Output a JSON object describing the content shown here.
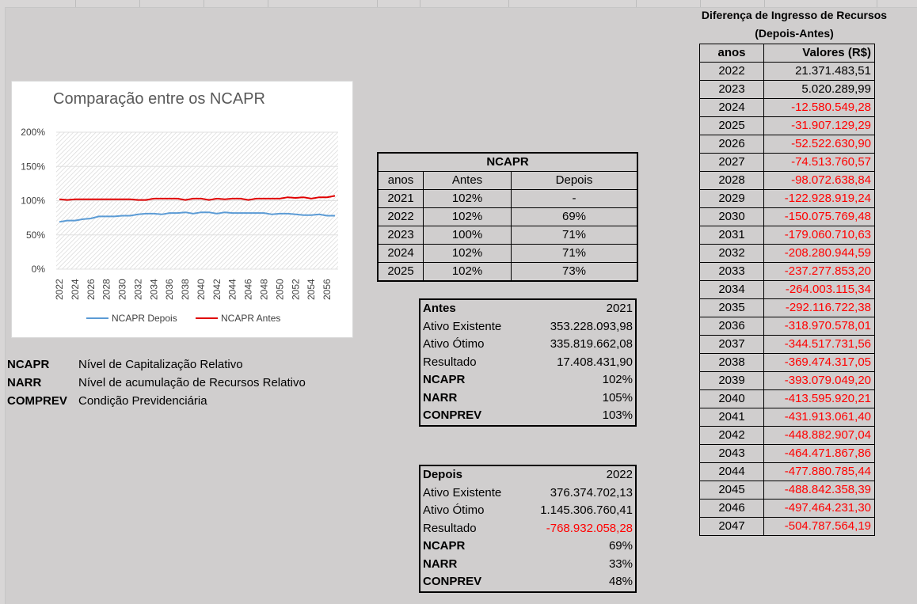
{
  "chart_data": {
    "type": "line",
    "title": "Comparação entre os NCAPR",
    "yticks": [
      "200%",
      "150%",
      "100%",
      "50%",
      "0%"
    ],
    "ylim": [
      0,
      200
    ],
    "x": [
      2022,
      2023,
      2024,
      2025,
      2026,
      2027,
      2028,
      2029,
      2030,
      2031,
      2032,
      2033,
      2034,
      2035,
      2036,
      2037,
      2038,
      2039,
      2040,
      2041,
      2042,
      2043,
      2044,
      2045,
      2046,
      2047,
      2048,
      2049,
      2050,
      2051,
      2052,
      2053,
      2054,
      2055,
      2056,
      2057
    ],
    "xtick_labels": [
      "2022",
      "2024",
      "2026",
      "2028",
      "2030",
      "2032",
      "2034",
      "2036",
      "2038",
      "2040",
      "2042",
      "2044",
      "2046",
      "2048",
      "2050",
      "2052",
      "2054",
      "2056"
    ],
    "series": [
      {
        "name": "NCAPR Depois",
        "color": "#5b9bd5",
        "values": [
          69,
          71,
          71,
          73,
          74,
          77,
          77,
          77,
          78,
          78,
          80,
          81,
          81,
          80,
          82,
          82,
          83,
          81,
          83,
          83,
          81,
          83,
          82,
          82,
          82,
          82,
          82,
          80,
          81,
          81,
          80,
          79,
          79,
          80,
          78,
          78
        ]
      },
      {
        "name": "NCAPR Antes",
        "color": "#e00000",
        "values": [
          102,
          101,
          102,
          102,
          102,
          102,
          102,
          102,
          102,
          102,
          101,
          101,
          103,
          103,
          103,
          103,
          101,
          103,
          103,
          101,
          103,
          102,
          103,
          103,
          101,
          103,
          103,
          103,
          103,
          105,
          104,
          105,
          103,
          105,
          105,
          107
        ]
      }
    ],
    "legend": "bottom",
    "grid": true
  },
  "glossary": [
    {
      "abbr": "NCAPR",
      "desc": "Nível de Capitalização Relativo"
    },
    {
      "abbr": "NARR",
      "desc": "Nível de acumulação de Recursos Relativo"
    },
    {
      "abbr": "COMPREV",
      "desc": "Condição Previdenciária"
    }
  ],
  "ncapr_table": {
    "title": "NCAPR",
    "headers": [
      "anos",
      "Antes",
      "Depois"
    ],
    "rows": [
      [
        "2021",
        "102%",
        "-"
      ],
      [
        "2022",
        "102%",
        "69%"
      ],
      [
        "2023",
        "100%",
        "71%"
      ],
      [
        "2024",
        "102%",
        "71%"
      ],
      [
        "2025",
        "102%",
        "73%"
      ]
    ]
  },
  "antes_table": {
    "rows": [
      {
        "label": "Antes",
        "value": "2021",
        "bold": true
      },
      {
        "label": "Ativo Existente",
        "value": "353.228.093,98"
      },
      {
        "label": "Ativo Ótimo",
        "value": "335.819.662,08"
      },
      {
        "label": "Resultado",
        "value": "17.408.431,90"
      },
      {
        "label": "NCAPR",
        "value": "102%",
        "bold": true
      },
      {
        "label": "NARR",
        "value": "105%",
        "bold": true
      },
      {
        "label": "CONPREV",
        "value": "103%",
        "bold": true
      }
    ]
  },
  "depois_table": {
    "rows": [
      {
        "label": "Depois",
        "value": "2022",
        "bold": true
      },
      {
        "label": "Ativo Existente",
        "value": "376.374.702,13"
      },
      {
        "label": "Ativo Ótimo",
        "value": "1.145.306.760,41"
      },
      {
        "label": "Resultado",
        "value": "-768.932.058,28",
        "negative": true
      },
      {
        "label": "NCAPR",
        "value": "69%",
        "bold": true
      },
      {
        "label": "NARR",
        "value": "33%",
        "bold": true
      },
      {
        "label": "CONPREV",
        "value": "48%",
        "bold": true
      }
    ]
  },
  "diff_table": {
    "title_line1": "Diferença de Ingresso de Recursos",
    "title_line2": "(Depois-Antes)",
    "headers": [
      "anos",
      "Valores (R$)"
    ],
    "rows": [
      [
        "2022",
        "21.371.483,51"
      ],
      [
        "2023",
        "5.020.289,99"
      ],
      [
        "2024",
        "-12.580.549,28"
      ],
      [
        "2025",
        "-31.907.129,29"
      ],
      [
        "2026",
        "-52.522.630,90"
      ],
      [
        "2027",
        "-74.513.760,57"
      ],
      [
        "2028",
        "-98.072.638,84"
      ],
      [
        "2029",
        "-122.928.919,24"
      ],
      [
        "2030",
        "-150.075.769,48"
      ],
      [
        "2031",
        "-179.060.710,63"
      ],
      [
        "2032",
        "-208.280.944,59"
      ],
      [
        "2033",
        "-237.277.853,20"
      ],
      [
        "2034",
        "-264.003.115,34"
      ],
      [
        "2035",
        "-292.116.722,38"
      ],
      [
        "2036",
        "-318.970.578,01"
      ],
      [
        "2037",
        "-344.517.731,56"
      ],
      [
        "2038",
        "-369.474.317,05"
      ],
      [
        "2039",
        "-393.079.049,20"
      ],
      [
        "2040",
        "-413.595.920,21"
      ],
      [
        "2041",
        "-431.913.061,40"
      ],
      [
        "2042",
        "-448.882.907,04"
      ],
      [
        "2043",
        "-464.471.867,86"
      ],
      [
        "2044",
        "-477.880.785,44"
      ],
      [
        "2045",
        "-488.842.358,39"
      ],
      [
        "2046",
        "-497.464.231,30"
      ],
      [
        "2047",
        "-504.787.564,19"
      ]
    ]
  },
  "colors": {
    "sheet_background": "#d0cece",
    "negative": "#ff0000",
    "depois_line": "#5b9bd5",
    "antes_line": "#e00000"
  }
}
